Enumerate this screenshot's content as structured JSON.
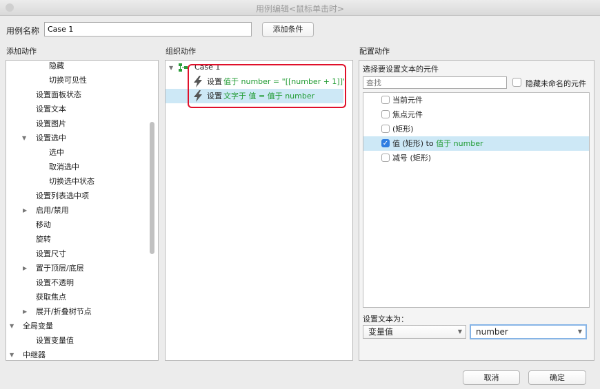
{
  "window": {
    "title": "用例编辑<鼠标单击时>"
  },
  "case_name": {
    "label": "用例名称",
    "value": "Case 1",
    "add_condition": "添加条件"
  },
  "add_actions": {
    "header": "添加动作",
    "items": [
      "隐藏",
      "切换可见性",
      "设置面板状态",
      "设置文本",
      "设置图片",
      "设置选中",
      "选中",
      "取消选中",
      "切换选中状态",
      "设置列表选中项",
      "启用/禁用",
      "移动",
      "旋转",
      "设置尺寸",
      "置于顶层/底层",
      "设置不透明",
      "获取焦点",
      "展开/折叠树节点",
      "全局变量",
      "设置变量值",
      "中继器"
    ]
  },
  "organize_actions": {
    "header": "组织动作",
    "case_label": "Case 1",
    "actions": [
      {
        "verb": "设置",
        "detail": "值于 number = \"[[number + 1]]\""
      },
      {
        "verb": "设置",
        "detail": "文字于 值 = 值于 number"
      }
    ]
  },
  "configure_actions": {
    "header": "配置动作",
    "select_label": "选择要设置文本的元件",
    "search_placeholder": "查找",
    "hide_unnamed_label": "隐藏未命名的元件",
    "widgets": [
      {
        "label": "当前元件",
        "suffix": "",
        "checked": false
      },
      {
        "label": "焦点元件",
        "suffix": "",
        "checked": false
      },
      {
        "label": "(矩形)",
        "suffix": "",
        "checked": false
      },
      {
        "label": "值 (矩形) to ",
        "suffix": "值于 number",
        "checked": true
      },
      {
        "label": "减号 (矩形)",
        "suffix": "",
        "checked": false
      }
    ],
    "set_text_label": "设置文本为：",
    "type_select": "变量值",
    "value_select": "number"
  },
  "footer": {
    "cancel": "取消",
    "ok": "确定"
  },
  "colors": {
    "highlight": "#cde8f6",
    "red_box": "#e0102a",
    "green": "#1e9a30",
    "check_blue": "#2f7de1"
  }
}
